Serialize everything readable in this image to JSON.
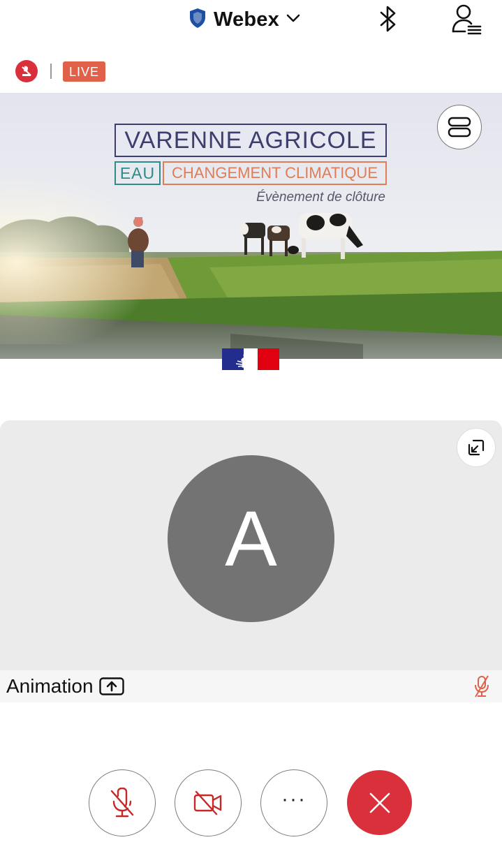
{
  "header": {
    "app_title": "Webex",
    "title_icon": "shield-icon",
    "dropdown_icon": "chevron-down-icon",
    "bluetooth_icon": "bluetooth-icon",
    "profile_icon": "participants-icon"
  },
  "status": {
    "recording_icon": "recording-icon",
    "live_label": "LIVE"
  },
  "shared_content": {
    "title": "VARENNE AGRICOLE",
    "tag_water": "EAU",
    "tag_climate": "CHANGEMENT CLIMATIQUE",
    "subtitle": "Évènement de clôture",
    "layout_icon": "layout-toggle-icon"
  },
  "participant": {
    "initial": "A",
    "name": "Animation",
    "presenter_icon": "share-upload-icon",
    "mic_status_icon": "mic-muted-icon",
    "collapse_icon": "collapse-icon"
  },
  "controls": {
    "mute_icon": "mic-muted-icon",
    "video_icon": "video-off-icon",
    "more_label": "···",
    "end_icon": "close-icon"
  },
  "colors": {
    "accent_red": "#d9303b",
    "live_badge": "#e0614a",
    "title_navy": "#3c3f6e",
    "tag_teal": "#2f8b86",
    "tag_orange": "#e07d55",
    "avatar_gray": "#737373"
  }
}
